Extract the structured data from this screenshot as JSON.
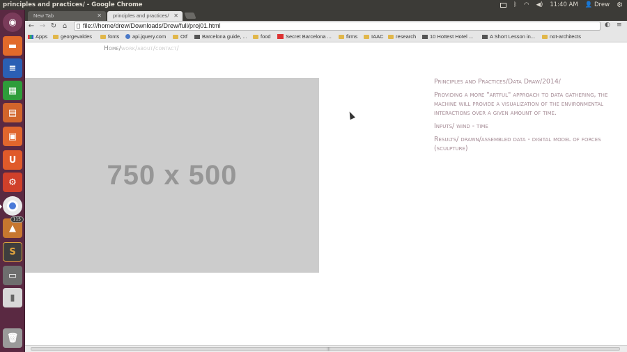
{
  "window_title": "principles and practices/ - Google Chrome",
  "indicators": {
    "time": "11:40 AM",
    "user": "Drew"
  },
  "launcher": {
    "items": [
      {
        "name": "dash-icon",
        "color": "#7a3b5a"
      },
      {
        "name": "files-icon",
        "color": "#e16a2a"
      },
      {
        "name": "writer-icon",
        "color": "#2b5fb4"
      },
      {
        "name": "calc-icon",
        "color": "#2e9d3a"
      },
      {
        "name": "impress-icon",
        "color": "#d2652b"
      },
      {
        "name": "software-center-icon",
        "color": "#e0662d"
      },
      {
        "name": "ubuntu-one-icon",
        "color": "#e05a2a"
      },
      {
        "name": "settings-icon",
        "color": "#d0402a"
      },
      {
        "name": "chrome-icon",
        "color": "#e8e8e8"
      },
      {
        "name": "updates-icon",
        "color": "#c7772f",
        "badge": "115"
      },
      {
        "name": "sublime-icon",
        "color": "#3e3e3e"
      },
      {
        "name": "workspace-icon",
        "color": "#6e6e6e"
      },
      {
        "name": "usb-drive-icon",
        "color": "#d8d8d8"
      },
      {
        "name": "trash-icon",
        "color": "#9a9a9a"
      }
    ]
  },
  "tabs": [
    {
      "label": "New Tab",
      "active": false
    },
    {
      "label": "principles and practices/",
      "active": true
    }
  ],
  "omnibox": {
    "url": "file:///home/drew/Downloads/Drew/full/proj01.html"
  },
  "bookmarks": [
    {
      "label": "Apps",
      "icon": "apps"
    },
    {
      "label": "georgevaldes",
      "icon": "folder"
    },
    {
      "label": "fonts",
      "icon": "folder"
    },
    {
      "label": "api.jquery.com",
      "icon": "blue"
    },
    {
      "label": "Otf",
      "icon": "folder"
    },
    {
      "label": "Barcelona guide, ...",
      "icon": "dark"
    },
    {
      "label": "food",
      "icon": "folder"
    },
    {
      "label": "Secret Barcelona ...",
      "icon": "red"
    },
    {
      "label": "firms",
      "icon": "folder"
    },
    {
      "label": "IAAC",
      "icon": "folder"
    },
    {
      "label": "research",
      "icon": "folder"
    },
    {
      "label": "10 Hottest Hotel ...",
      "icon": "dark"
    },
    {
      "label": "A Short Lesson in...",
      "icon": "dark"
    },
    {
      "label": "not-architects",
      "icon": "folder"
    }
  ],
  "site": {
    "nav": {
      "home": "Home",
      "work": "work",
      "about": "about",
      "contact": "contact"
    },
    "placeholder": "750 x 500",
    "description": [
      "Principles and Practices/Data Draw/2014/",
      "Providing a more \"artful\" approach to data gathering, the machine will provide a visualization of the environmental interactions over a given amount of time.",
      "Inputs/ wind - time",
      "Results/ drawn/assembled data - digital model of forces (sculpture)"
    ]
  },
  "colors": {
    "panel": "#3c3b37",
    "launcher": "#5a2942",
    "desc_text": "#a58b95",
    "placeholder": "#cccccc"
  }
}
